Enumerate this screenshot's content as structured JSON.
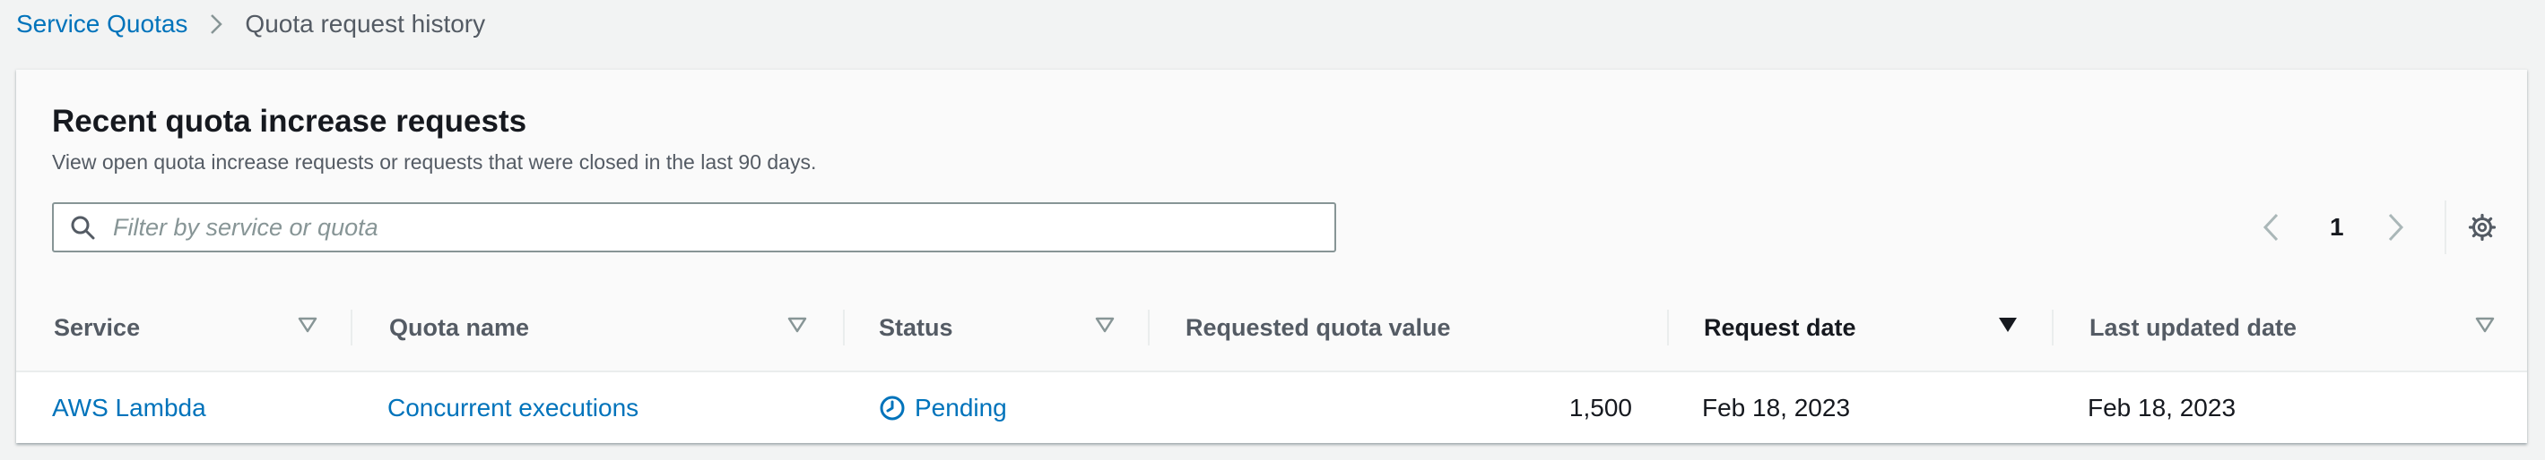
{
  "breadcrumb": {
    "root": "Service Quotas",
    "current": "Quota request history"
  },
  "panel": {
    "title": "Recent quota increase requests",
    "description": "View open quota increase requests or requests that were closed in the last 90 days."
  },
  "search": {
    "placeholder": "Filter by service or quota",
    "value": ""
  },
  "pagination": {
    "current_page": "1"
  },
  "table": {
    "columns": [
      "Service",
      "Quota name",
      "Status",
      "Requested quota value",
      "Request date",
      "Last updated date"
    ],
    "sorted_column": "Request date",
    "rows": [
      {
        "service": "AWS Lambda",
        "quota_name": "Concurrent executions",
        "status": "Pending",
        "requested_value": "1,500",
        "request_date": "Feb 18, 2023",
        "last_updated": "Feb 18, 2023"
      }
    ]
  },
  "icons": {
    "breadcrumb_separator": "chevron-right-icon",
    "search": "search-icon",
    "prev_page": "chevron-left-icon",
    "next_page": "chevron-right-icon",
    "settings": "gear-icon",
    "sort_unsorted": "caret-down-outline-icon",
    "sort_active": "caret-down-filled-icon",
    "status_pending": "clock-icon"
  },
  "colors": {
    "link": "#0073bb",
    "text": "#16191f",
    "muted_text": "#545b64",
    "background": "#f2f3f3",
    "border": "#eaeded"
  }
}
